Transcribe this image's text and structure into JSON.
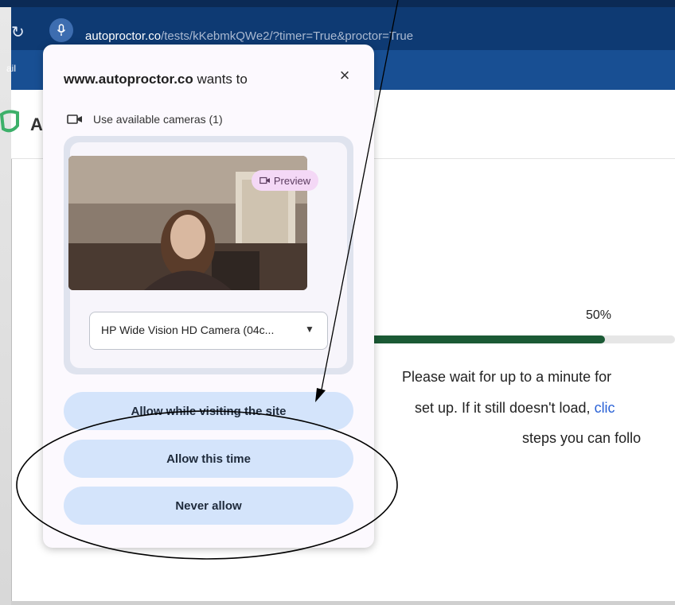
{
  "browser": {
    "url_host": "autoproctor.co",
    "url_path": "/tests/kKebmkQWe2/?timer=True&proctor=True",
    "bookmark_fragment": "ail",
    "refresh_glyph": "↻"
  },
  "page": {
    "brand_fragment": "A",
    "progress": {
      "label": "50%",
      "value_fraction": 0.5
    },
    "message_lines": [
      "Please wait for up to a minute for",
      "set up. If it still doesn't load, ",
      "steps you can follo"
    ],
    "message_link": "clic"
  },
  "popup": {
    "title_host": "www.autoproctor.co",
    "title_suffix": " wants to",
    "close_glyph": "×",
    "camera_permission_label": "Use available cameras (1)",
    "preview_label": "Preview",
    "camera_select_value": "HP Wide Vision HD Camera (04c...",
    "buttons": {
      "allow_while_visiting": "Allow while visiting the site",
      "allow_this_time": "Allow this time",
      "never_allow": "Never allow"
    }
  },
  "colors": {
    "address_bar": "#0e3a73",
    "progress_fill": "#1b5a35",
    "button_bg": "#d4e4fb",
    "link": "#2a62d6"
  },
  "icons": [
    "refresh-icon",
    "microphone-icon",
    "shield-logo-icon",
    "camera-icon",
    "video-preview-icon",
    "caret-down-icon",
    "close-icon"
  ]
}
